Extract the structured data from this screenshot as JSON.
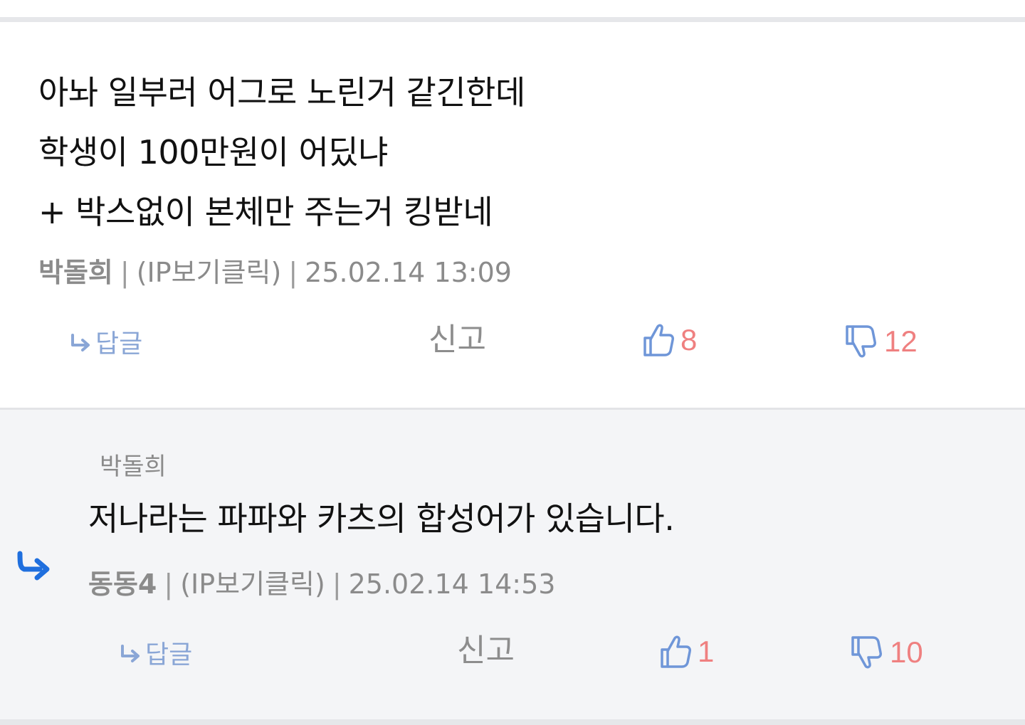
{
  "comment": {
    "lines": [
      "아놔 일부러 어그로 노린거 같긴한데",
      "학생이 100만원이 어딨냐",
      "+ 박스없이 본체만 주는거 킹받네"
    ],
    "author": "박돌희",
    "sep": "|",
    "ip": "(IP보기클릭)",
    "timestamp": "25.02.14 13:09",
    "reply_label": "답글",
    "report_label": "신고",
    "likes": "8",
    "dislikes": "12"
  },
  "reply": {
    "quoted_author": "박돌희",
    "text": "저나라는 파파와 카츠의 합성어가 있습니다.",
    "author": "동동4",
    "sep": "|",
    "ip": "(IP보기클릭)",
    "timestamp": "25.02.14 14:53",
    "reply_label": "답글",
    "report_label": "신고",
    "likes": "1",
    "dislikes": "10"
  },
  "icons": {
    "reply_small": "reply-arrow-icon",
    "thumbs_up": "thumbs-up-icon",
    "thumbs_down": "thumbs-down-icon",
    "reply_indicator": "reply-indicator-icon"
  },
  "colors": {
    "vote_count": "#ef8080",
    "reply_link": "#8aa6d6",
    "icon_blue": "#6f96d8",
    "reply_indicator": "#1f6fde",
    "reply_bg": "#f4f5f7"
  }
}
